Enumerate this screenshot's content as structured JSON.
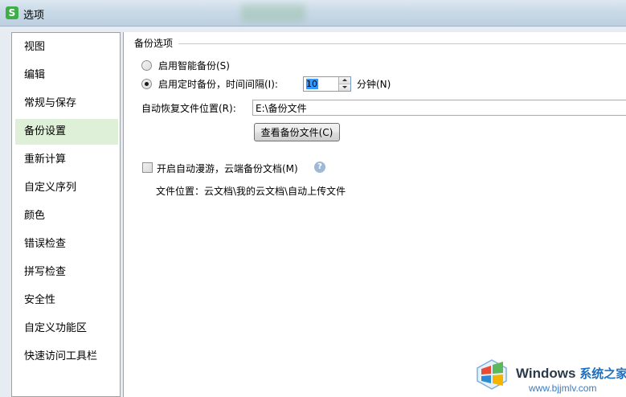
{
  "window": {
    "title": "选项",
    "app_icon_glyph": "S",
    "app_icon_color": "#3fae49"
  },
  "sidebar": {
    "selected_index": 3,
    "items": [
      {
        "label": "视图"
      },
      {
        "label": "编辑"
      },
      {
        "label": "常规与保存"
      },
      {
        "label": "备份设置"
      },
      {
        "label": "重新计算"
      },
      {
        "label": "自定义序列"
      },
      {
        "label": "颜色"
      },
      {
        "label": "错误检查"
      },
      {
        "label": "拼写检查"
      },
      {
        "label": "安全性"
      },
      {
        "label": "自定义功能区"
      },
      {
        "label": "快速访问工具栏"
      }
    ]
  },
  "backup": {
    "section_title": "备份选项",
    "smart_backup_label": "启用智能备份(S)",
    "smart_backup_checked": false,
    "timed_backup_label": "启用定时备份，时间间隔(I):",
    "timed_backup_checked": true,
    "interval_value": "10",
    "interval_unit": "分钟(N)",
    "recovery_location_label": "自动恢复文件位置(R):",
    "recovery_location_value": "E:\\备份文件",
    "view_backup_button": "查看备份文件(C)"
  },
  "cloud": {
    "roaming_label": "开启自动漫游，云端备份文档(M)",
    "roaming_checked": false,
    "help_glyph": "?",
    "file_location_text": "文件位置：云文档\\我的云文档\\自动上传文件"
  },
  "watermark": {
    "brand": "Windows",
    "brand_cn": "系统之家",
    "url": "www.bjjmlv.com"
  }
}
